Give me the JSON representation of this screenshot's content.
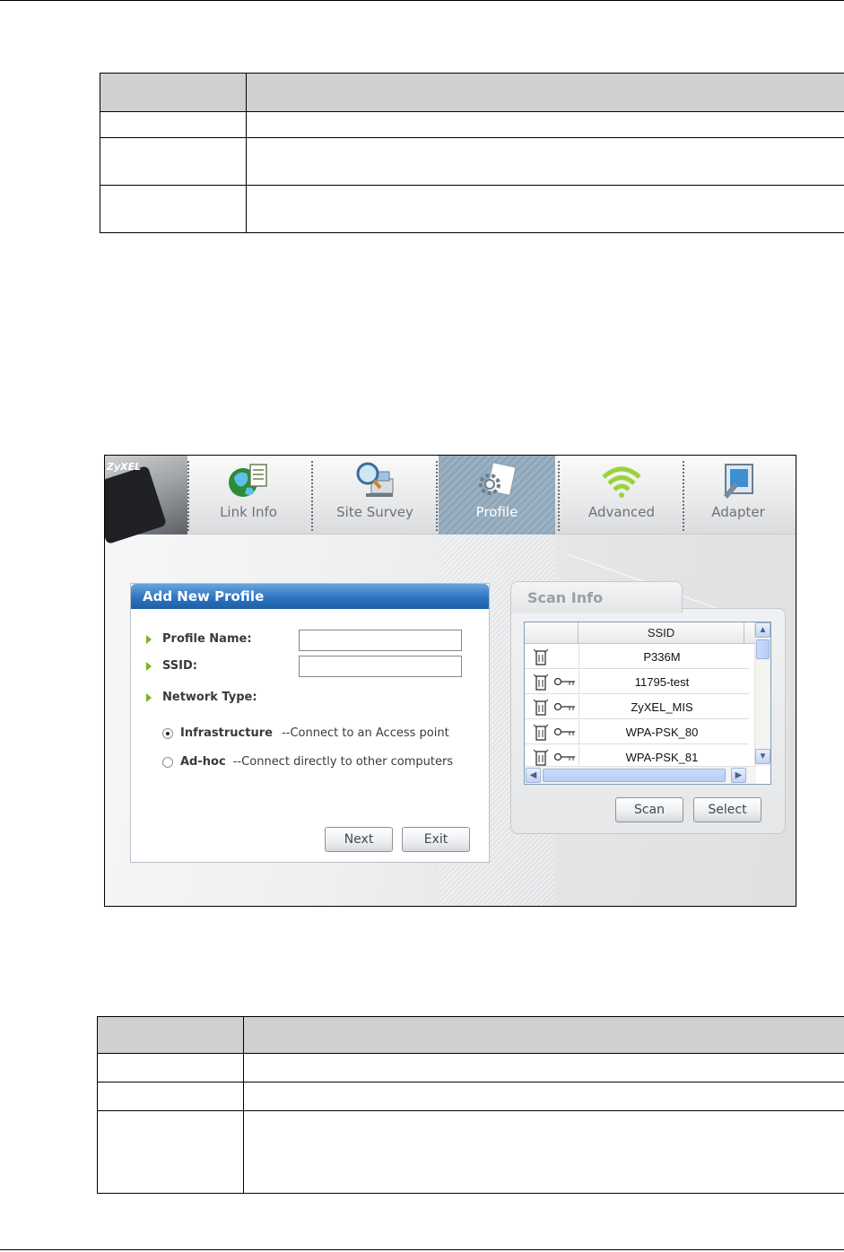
{
  "profile_tool": {
    "brand": "ZyXEL",
    "tabs": [
      {
        "label": "Link Info",
        "icon": "globe-document-icon"
      },
      {
        "label": "Site Survey",
        "icon": "magnifier-network-icon"
      },
      {
        "label": "Profile",
        "icon": "gear-document-icon",
        "active": true
      },
      {
        "label": "Advanced",
        "icon": "wireless-waves-icon"
      },
      {
        "label": "Adapter",
        "icon": "adapter-card-icon"
      }
    ],
    "add_profile": {
      "title": "Add New Profile",
      "profile_name_label": "Profile Name:",
      "profile_name_value": "",
      "ssid_label": "SSID:",
      "ssid_value": "",
      "network_type_label": "Network Type:",
      "infrastructure_label": "Infrastructure",
      "infrastructure_desc": "--Connect to an Access point",
      "infrastructure_selected": true,
      "adhoc_label": "Ad-hoc",
      "adhoc_desc": "--Connect directly to other computers",
      "adhoc_selected": false,
      "next_button": "Next",
      "exit_button": "Exit"
    },
    "scan_info": {
      "title": "Scan Info",
      "column_header": "SSID",
      "networks": [
        {
          "ssid": "P336M",
          "secured": false
        },
        {
          "ssid": "11795-test",
          "secured": true
        },
        {
          "ssid": "ZyXEL_MIS",
          "secured": true
        },
        {
          "ssid": "WPA-PSK_80",
          "secured": true
        },
        {
          "ssid": "WPA-PSK_81",
          "secured": true
        }
      ],
      "scan_button": "Scan",
      "select_button": "Select"
    }
  },
  "colors": {
    "header_blue": "#2d73bf",
    "bullet_green": "#79b51b",
    "active_tab": "#8ea6b8",
    "table_header": "#d0d0d0"
  }
}
